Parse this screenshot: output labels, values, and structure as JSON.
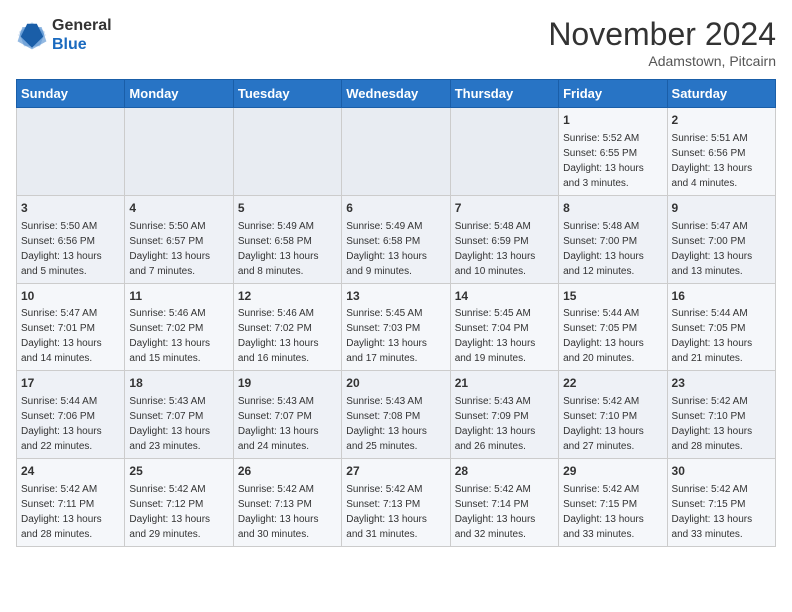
{
  "logo": {
    "general": "General",
    "blue": "Blue"
  },
  "header": {
    "month": "November 2024",
    "location": "Adamstown, Pitcairn"
  },
  "days_of_week": [
    "Sunday",
    "Monday",
    "Tuesday",
    "Wednesday",
    "Thursday",
    "Friday",
    "Saturday"
  ],
  "weeks": [
    [
      {
        "day": "",
        "info": ""
      },
      {
        "day": "",
        "info": ""
      },
      {
        "day": "",
        "info": ""
      },
      {
        "day": "",
        "info": ""
      },
      {
        "day": "",
        "info": ""
      },
      {
        "day": "1",
        "info": "Sunrise: 5:52 AM\nSunset: 6:55 PM\nDaylight: 13 hours and 3 minutes."
      },
      {
        "day": "2",
        "info": "Sunrise: 5:51 AM\nSunset: 6:56 PM\nDaylight: 13 hours and 4 minutes."
      }
    ],
    [
      {
        "day": "3",
        "info": "Sunrise: 5:50 AM\nSunset: 6:56 PM\nDaylight: 13 hours and 5 minutes."
      },
      {
        "day": "4",
        "info": "Sunrise: 5:50 AM\nSunset: 6:57 PM\nDaylight: 13 hours and 7 minutes."
      },
      {
        "day": "5",
        "info": "Sunrise: 5:49 AM\nSunset: 6:58 PM\nDaylight: 13 hours and 8 minutes."
      },
      {
        "day": "6",
        "info": "Sunrise: 5:49 AM\nSunset: 6:58 PM\nDaylight: 13 hours and 9 minutes."
      },
      {
        "day": "7",
        "info": "Sunrise: 5:48 AM\nSunset: 6:59 PM\nDaylight: 13 hours and 10 minutes."
      },
      {
        "day": "8",
        "info": "Sunrise: 5:48 AM\nSunset: 7:00 PM\nDaylight: 13 hours and 12 minutes."
      },
      {
        "day": "9",
        "info": "Sunrise: 5:47 AM\nSunset: 7:00 PM\nDaylight: 13 hours and 13 minutes."
      }
    ],
    [
      {
        "day": "10",
        "info": "Sunrise: 5:47 AM\nSunset: 7:01 PM\nDaylight: 13 hours and 14 minutes."
      },
      {
        "day": "11",
        "info": "Sunrise: 5:46 AM\nSunset: 7:02 PM\nDaylight: 13 hours and 15 minutes."
      },
      {
        "day": "12",
        "info": "Sunrise: 5:46 AM\nSunset: 7:02 PM\nDaylight: 13 hours and 16 minutes."
      },
      {
        "day": "13",
        "info": "Sunrise: 5:45 AM\nSunset: 7:03 PM\nDaylight: 13 hours and 17 minutes."
      },
      {
        "day": "14",
        "info": "Sunrise: 5:45 AM\nSunset: 7:04 PM\nDaylight: 13 hours and 19 minutes."
      },
      {
        "day": "15",
        "info": "Sunrise: 5:44 AM\nSunset: 7:05 PM\nDaylight: 13 hours and 20 minutes."
      },
      {
        "day": "16",
        "info": "Sunrise: 5:44 AM\nSunset: 7:05 PM\nDaylight: 13 hours and 21 minutes."
      }
    ],
    [
      {
        "day": "17",
        "info": "Sunrise: 5:44 AM\nSunset: 7:06 PM\nDaylight: 13 hours and 22 minutes."
      },
      {
        "day": "18",
        "info": "Sunrise: 5:43 AM\nSunset: 7:07 PM\nDaylight: 13 hours and 23 minutes."
      },
      {
        "day": "19",
        "info": "Sunrise: 5:43 AM\nSunset: 7:07 PM\nDaylight: 13 hours and 24 minutes."
      },
      {
        "day": "20",
        "info": "Sunrise: 5:43 AM\nSunset: 7:08 PM\nDaylight: 13 hours and 25 minutes."
      },
      {
        "day": "21",
        "info": "Sunrise: 5:43 AM\nSunset: 7:09 PM\nDaylight: 13 hours and 26 minutes."
      },
      {
        "day": "22",
        "info": "Sunrise: 5:42 AM\nSunset: 7:10 PM\nDaylight: 13 hours and 27 minutes."
      },
      {
        "day": "23",
        "info": "Sunrise: 5:42 AM\nSunset: 7:10 PM\nDaylight: 13 hours and 28 minutes."
      }
    ],
    [
      {
        "day": "24",
        "info": "Sunrise: 5:42 AM\nSunset: 7:11 PM\nDaylight: 13 hours and 28 minutes."
      },
      {
        "day": "25",
        "info": "Sunrise: 5:42 AM\nSunset: 7:12 PM\nDaylight: 13 hours and 29 minutes."
      },
      {
        "day": "26",
        "info": "Sunrise: 5:42 AM\nSunset: 7:13 PM\nDaylight: 13 hours and 30 minutes."
      },
      {
        "day": "27",
        "info": "Sunrise: 5:42 AM\nSunset: 7:13 PM\nDaylight: 13 hours and 31 minutes."
      },
      {
        "day": "28",
        "info": "Sunrise: 5:42 AM\nSunset: 7:14 PM\nDaylight: 13 hours and 32 minutes."
      },
      {
        "day": "29",
        "info": "Sunrise: 5:42 AM\nSunset: 7:15 PM\nDaylight: 13 hours and 33 minutes."
      },
      {
        "day": "30",
        "info": "Sunrise: 5:42 AM\nSunset: 7:15 PM\nDaylight: 13 hours and 33 minutes."
      }
    ]
  ]
}
